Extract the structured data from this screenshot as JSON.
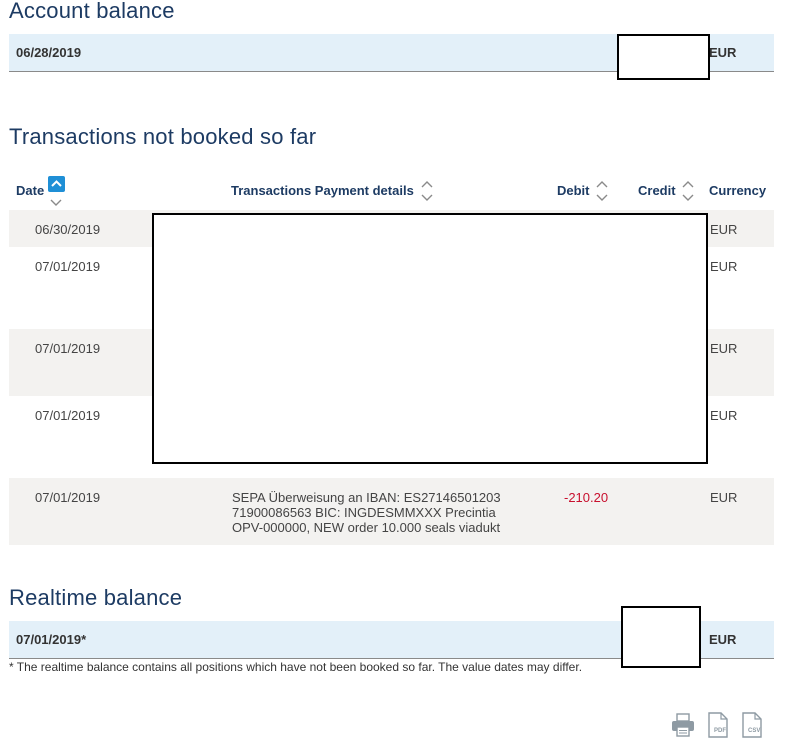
{
  "account_balance": {
    "title": "Account balance",
    "date": "06/28/2019",
    "currency": "EUR"
  },
  "transactions": {
    "title": "Transactions not booked so far",
    "columns": {
      "date": "Date",
      "details": "Transactions Payment details",
      "debit": "Debit",
      "credit": "Credit",
      "currency": "Currency"
    },
    "rows": [
      {
        "date": "06/30/2019",
        "details_line1": "",
        "details_line2": "",
        "details_line3": "",
        "debit": "",
        "credit": "",
        "currency": "EUR"
      },
      {
        "date": "07/01/2019",
        "details_line1": "",
        "details_line2": "",
        "details_line3": "",
        "debit": "",
        "credit": "",
        "currency": "EUR"
      },
      {
        "date": "07/01/2019",
        "details_line1": "",
        "details_line2": "",
        "details_line3": "",
        "debit": "",
        "credit": "",
        "currency": "EUR"
      },
      {
        "date": "07/01/2019",
        "details_line1": "",
        "details_line2": "",
        "details_line3": "",
        "debit": "",
        "credit": "",
        "currency": "EUR"
      },
      {
        "date": "07/01/2019",
        "details_line1": "SEPA Überweisung an IBAN: ES27146501203",
        "details_line2": "71900086563 BIC: INGDESMMXXX Precintia",
        "details_line3": "OPV-000000, NEW order 10.000 seals viadukt",
        "debit": "-210.20",
        "credit": "",
        "currency": "EUR"
      }
    ]
  },
  "realtime_balance": {
    "title": "Realtime balance",
    "date": "07/01/2019*",
    "currency": "EUR",
    "footnote": "* The realtime balance contains all positions which have not been booked so far. The value dates may differ."
  },
  "toolbar": {
    "print_icon": "printer-icon",
    "pdf_label": "PDF",
    "csv_label": "CSV"
  }
}
